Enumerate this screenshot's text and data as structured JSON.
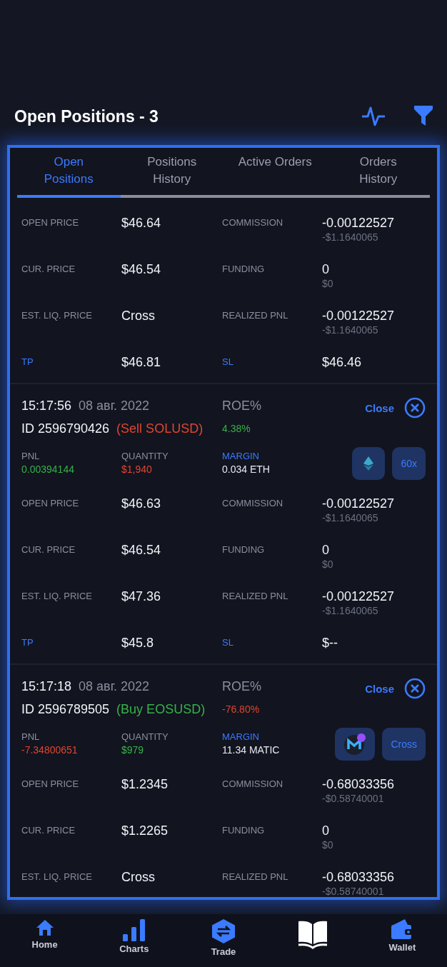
{
  "header": {
    "title": "Open Positions - 3"
  },
  "tabs": [
    {
      "label": "Open\nPositions",
      "selected": true
    },
    {
      "label": "Positions\nHistory",
      "selected": false
    },
    {
      "label": "Active Orders",
      "selected": false
    },
    {
      "label": "Orders\nHistory",
      "selected": false
    }
  ],
  "positions": [
    {
      "details": [
        {
          "cells": [
            {
              "label": "OPEN PRICE",
              "accent": false,
              "value": "$46.64"
            },
            {
              "label": "COMMISSION",
              "accent": false,
              "value": "-0.00122527",
              "sub": "-$1.1640065"
            }
          ]
        },
        {
          "cells": [
            {
              "label": "CUR. PRICE",
              "accent": false,
              "value": "$46.54"
            },
            {
              "label": "FUNDING",
              "accent": false,
              "value": "0",
              "sub": "$0"
            }
          ]
        },
        {
          "cells": [
            {
              "label": "EST. LIQ. PRICE",
              "accent": false,
              "value": "Cross"
            },
            {
              "label": "REALIZED PNL",
              "accent": false,
              "value": "-0.00122527",
              "sub": "-$1.1640065"
            }
          ]
        },
        {
          "cells": [
            {
              "label": "TP",
              "accent": true,
              "value": "$46.81"
            },
            {
              "label": "SL",
              "accent": true,
              "value": "$46.46"
            }
          ]
        }
      ]
    },
    {
      "time": "15:17:56",
      "date": "08 авг. 2022",
      "roe_label": "ROE%",
      "roe": {
        "text": "4.38%",
        "color": "#35b24a"
      },
      "id": "ID 2596790426",
      "side": {
        "text": "(Sell SOLUSD)",
        "color": "#e0452f"
      },
      "close_label": "Close",
      "metrics": [
        {
          "label": "PNL",
          "accent": false,
          "value": "0.00394144",
          "color": "#35b24a"
        },
        {
          "label": "QUANTITY",
          "accent": false,
          "value": "$1,940",
          "color": "#e0452f"
        },
        {
          "label": "MARGIN",
          "accent": true,
          "value": "0.034 ETH",
          "color": "#e8eaf0"
        }
      ],
      "badges": [
        {
          "kind": "eth"
        },
        {
          "kind": "text",
          "label": "60x"
        }
      ],
      "details": [
        {
          "cells": [
            {
              "label": "OPEN PRICE",
              "accent": false,
              "value": "$46.63"
            },
            {
              "label": "COMMISSION",
              "accent": false,
              "value": "-0.00122527",
              "sub": "-$1.1640065"
            }
          ]
        },
        {
          "cells": [
            {
              "label": "CUR. PRICE",
              "accent": false,
              "value": "$46.54"
            },
            {
              "label": "FUNDING",
              "accent": false,
              "value": "0",
              "sub": "$0"
            }
          ]
        },
        {
          "cells": [
            {
              "label": "EST. LIQ. PRICE",
              "accent": false,
              "value": "$47.36"
            },
            {
              "label": "REALIZED PNL",
              "accent": false,
              "value": "-0.00122527",
              "sub": "-$1.1640065"
            }
          ]
        },
        {
          "cells": [
            {
              "label": "TP",
              "accent": true,
              "value": "$45.8"
            },
            {
              "label": "SL",
              "accent": true,
              "value": "$--"
            }
          ]
        }
      ]
    },
    {
      "time": "15:17:18",
      "date": "08 авг. 2022",
      "roe_label": "ROE%",
      "roe": {
        "text": "-76.80%",
        "color": "#e0452f"
      },
      "id": "ID 2596789505",
      "side": {
        "text": "(Buy EOSUSD)",
        "color": "#35b24a"
      },
      "close_label": "Close",
      "metrics": [
        {
          "label": "PNL",
          "accent": false,
          "value": "-7.34800651",
          "color": "#e0452f"
        },
        {
          "label": "QUANTITY",
          "accent": false,
          "value": "$979",
          "color": "#35b24a"
        },
        {
          "label": "MARGIN",
          "accent": true,
          "value": "11.34 MATIC",
          "color": "#e8eaf0"
        }
      ],
      "badges": [
        {
          "kind": "matic"
        },
        {
          "kind": "text",
          "label": "Cross"
        }
      ],
      "details": [
        {
          "cells": [
            {
              "label": "OPEN PRICE",
              "accent": false,
              "value": "$1.2345"
            },
            {
              "label": "COMMISSION",
              "accent": false,
              "value": "-0.68033356",
              "sub": "-$0.58740001"
            }
          ]
        },
        {
          "cells": [
            {
              "label": "CUR. PRICE",
              "accent": false,
              "value": "$1.2265"
            },
            {
              "label": "FUNDING",
              "accent": false,
              "value": "0",
              "sub": "$0"
            }
          ]
        },
        {
          "cells": [
            {
              "label": "EST. LIQ. PRICE",
              "accent": false,
              "value": "Cross"
            },
            {
              "label": "REALIZED PNL",
              "accent": false,
              "value": "-0.68033356",
              "sub": "-$0.58740001"
            }
          ]
        }
      ]
    }
  ],
  "nav": [
    {
      "kind": "home",
      "label": "Home",
      "selected": false
    },
    {
      "kind": "charts",
      "label": "Charts",
      "selected": false
    },
    {
      "kind": "trade",
      "label": "Trade",
      "selected": false
    },
    {
      "kind": "book",
      "selected": true
    },
    {
      "kind": "wallet",
      "label": "Wallet",
      "selected": false
    }
  ]
}
